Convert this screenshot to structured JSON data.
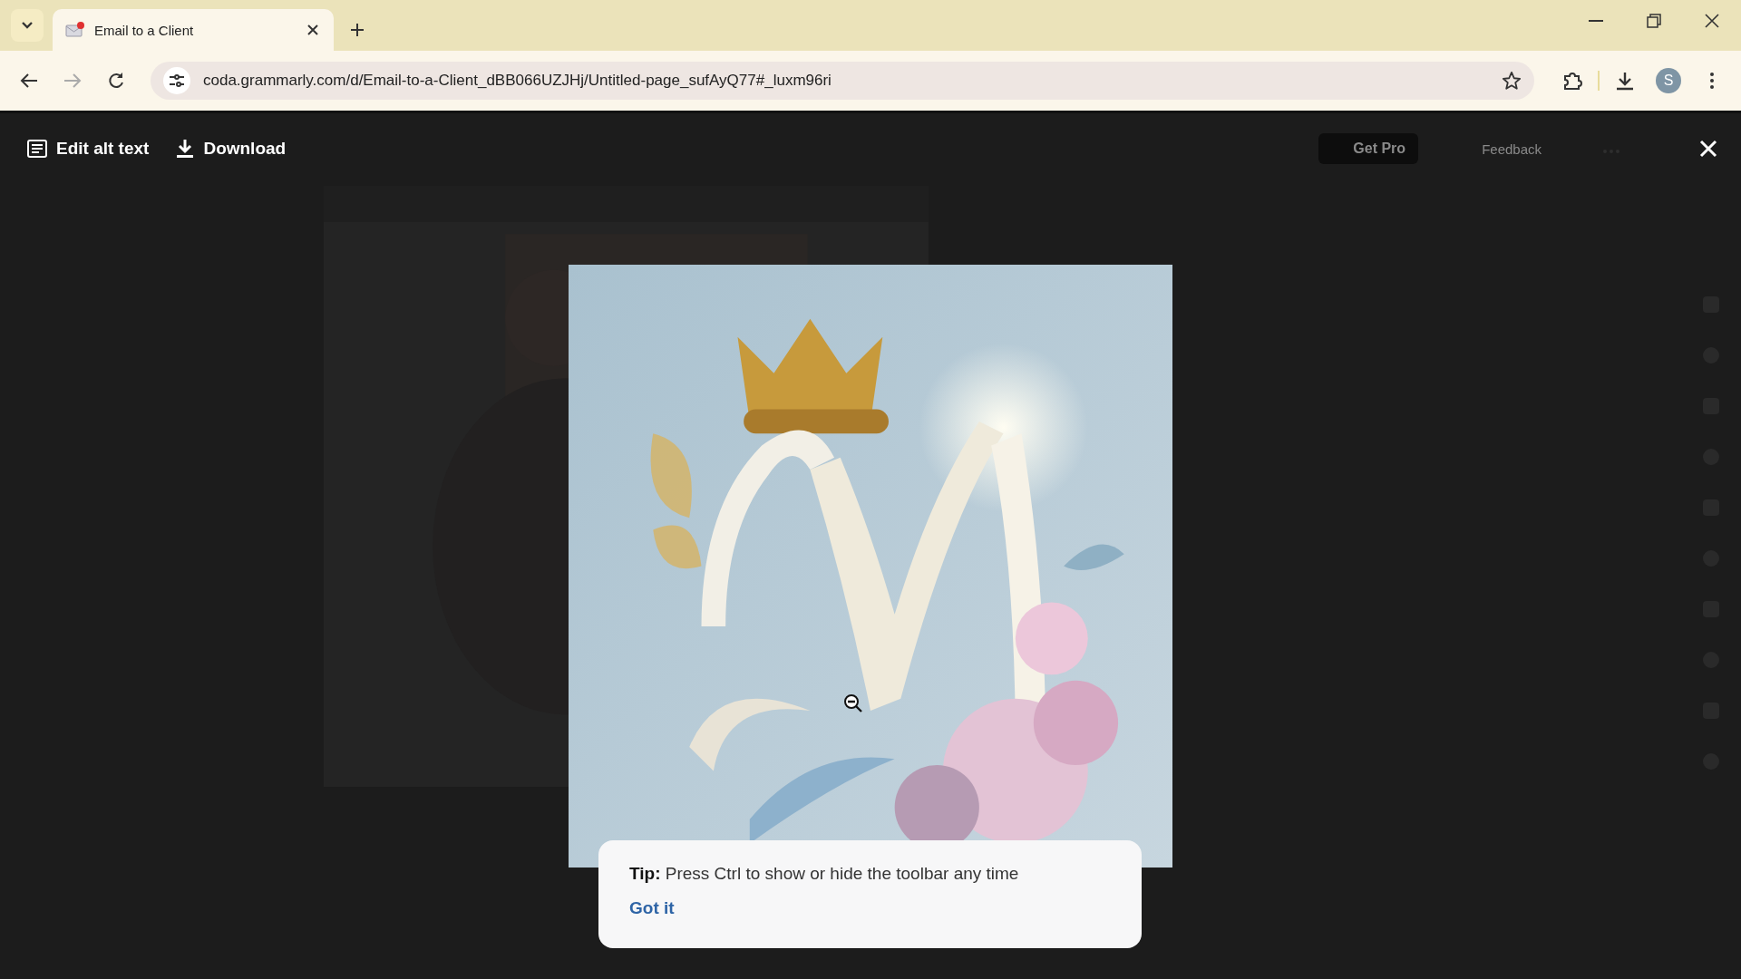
{
  "browser": {
    "tabs": [
      {
        "title": "Email to a Client",
        "selected": true
      }
    ],
    "url": "coda.grammarly.com/d/Email-to-a-Client_dBB066UZJHj/Untitled-page_sufAyQ77#_luxm96ri",
    "profile_initial": "S"
  },
  "viewer": {
    "actions": [
      {
        "label": "Edit alt text",
        "kind": "alt-text"
      },
      {
        "label": "Download",
        "kind": "download"
      }
    ],
    "background_actions": [
      "Get Pro",
      "Feedback"
    ]
  },
  "tip": {
    "text": "**Tip:** Press Ctrl to show or hide the toolbar any time",
    "action": "Got it"
  }
}
